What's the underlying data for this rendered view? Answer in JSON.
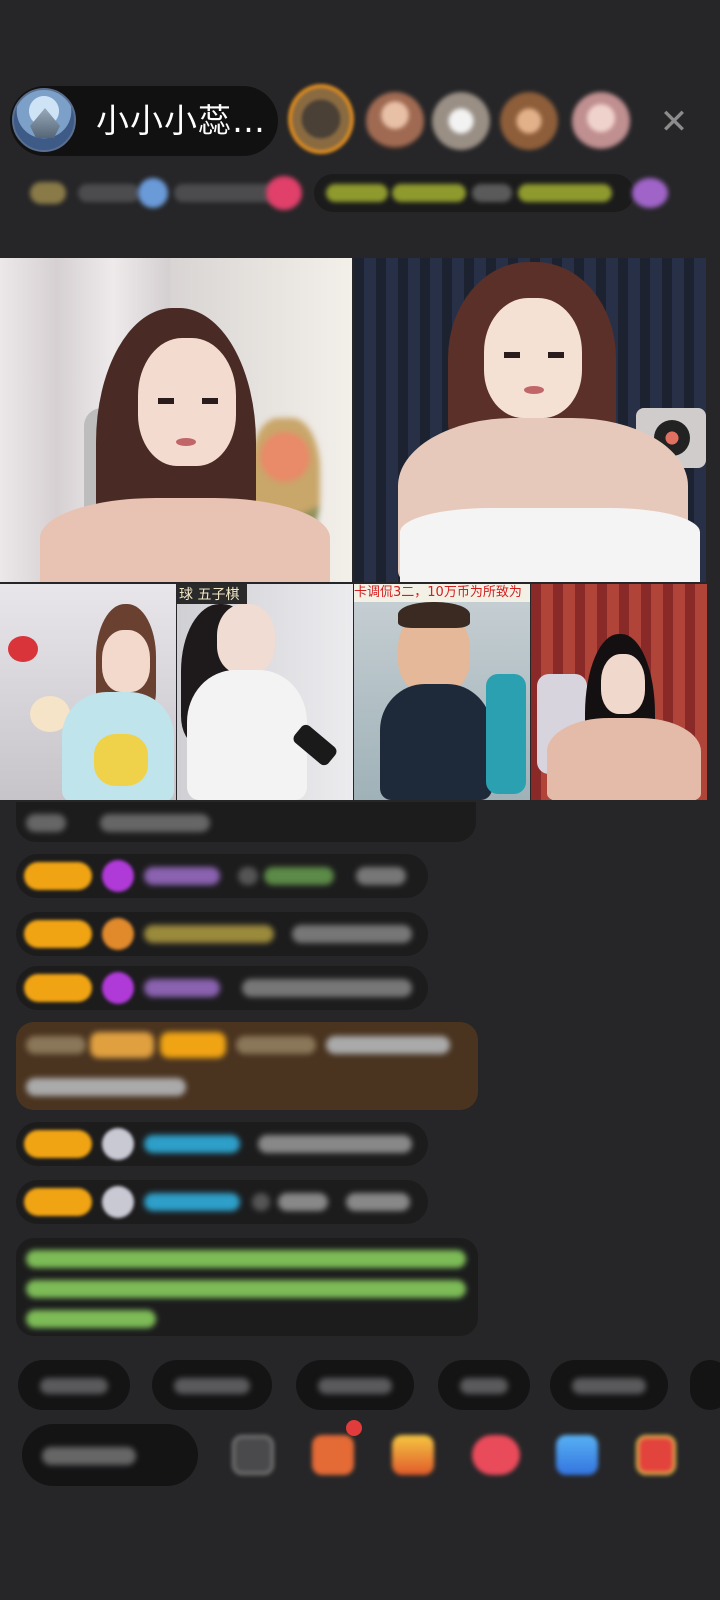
{
  "header": {
    "host_name": "小小小蕊…",
    "close_glyph": "✕"
  },
  "grid": {
    "tile_labels": {
      "tile4": "球  五子棋",
      "tile5": "卡调侃3二，10万币为所致为"
    }
  },
  "colors": {
    "background": "#262628",
    "badge_gold": "#f0a414",
    "gem_purple": "#b03ad8",
    "chat_green": "#7dbb57",
    "chat_cyan": "#2e9fc9",
    "notice_brown": "#4a3420"
  },
  "icons": [
    "close-icon",
    "gift-icon",
    "box-icon",
    "share-icon",
    "shop-icon"
  ]
}
